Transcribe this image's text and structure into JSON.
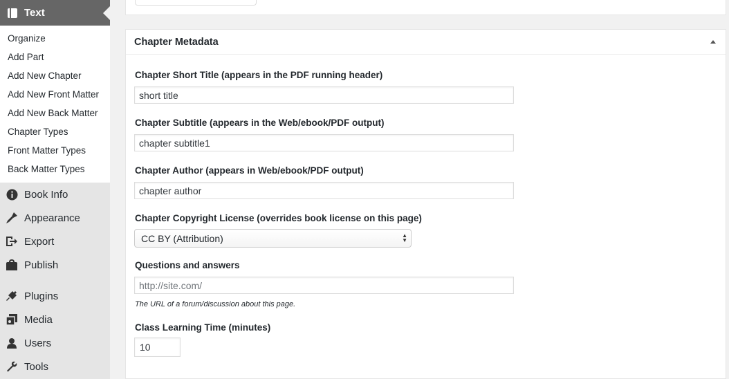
{
  "sidebar": {
    "current": {
      "label": "Text",
      "icon": "book-icon"
    },
    "submenu": [
      "Organize",
      "Add Part",
      "Add New Chapter",
      "Add New Front Matter",
      "Add New Back Matter",
      "Chapter Types",
      "Front Matter Types",
      "Back Matter Types"
    ],
    "group1": [
      {
        "label": "Book Info",
        "icon": "info-icon"
      },
      {
        "label": "Appearance",
        "icon": "brush-icon"
      },
      {
        "label": "Export",
        "icon": "export-icon"
      },
      {
        "label": "Publish",
        "icon": "store-icon"
      }
    ],
    "group2": [
      {
        "label": "Plugins",
        "icon": "plug-icon"
      },
      {
        "label": "Media",
        "icon": "media-icon"
      },
      {
        "label": "Users",
        "icon": "user-icon"
      },
      {
        "label": "Tools",
        "icon": "wrench-icon"
      }
    ]
  },
  "metabox": {
    "title": "Chapter Metadata",
    "fields": {
      "short_title": {
        "label": "Chapter Short Title (appears in the PDF running header)",
        "value": "short title"
      },
      "subtitle": {
        "label": "Chapter Subtitle (appears in the Web/ebook/PDF output)",
        "value": "chapter subtitle1"
      },
      "author": {
        "label": "Chapter Author (appears in Web/ebook/PDF output)",
        "value": "chapter author"
      },
      "license": {
        "label": "Chapter Copyright License (overrides book license on this page)",
        "value": "CC BY (Attribution)"
      },
      "qa": {
        "label": "Questions and answers",
        "placeholder": "http://site.com/",
        "hint": "The URL of a forum/discussion about this page."
      },
      "learning_time": {
        "label": "Class Learning Time (minutes)",
        "value": "10"
      }
    }
  },
  "colors": {
    "sidebar_bg": "#e5e5e5",
    "current_bg": "#666666",
    "page_bg": "#f1f1f1"
  }
}
